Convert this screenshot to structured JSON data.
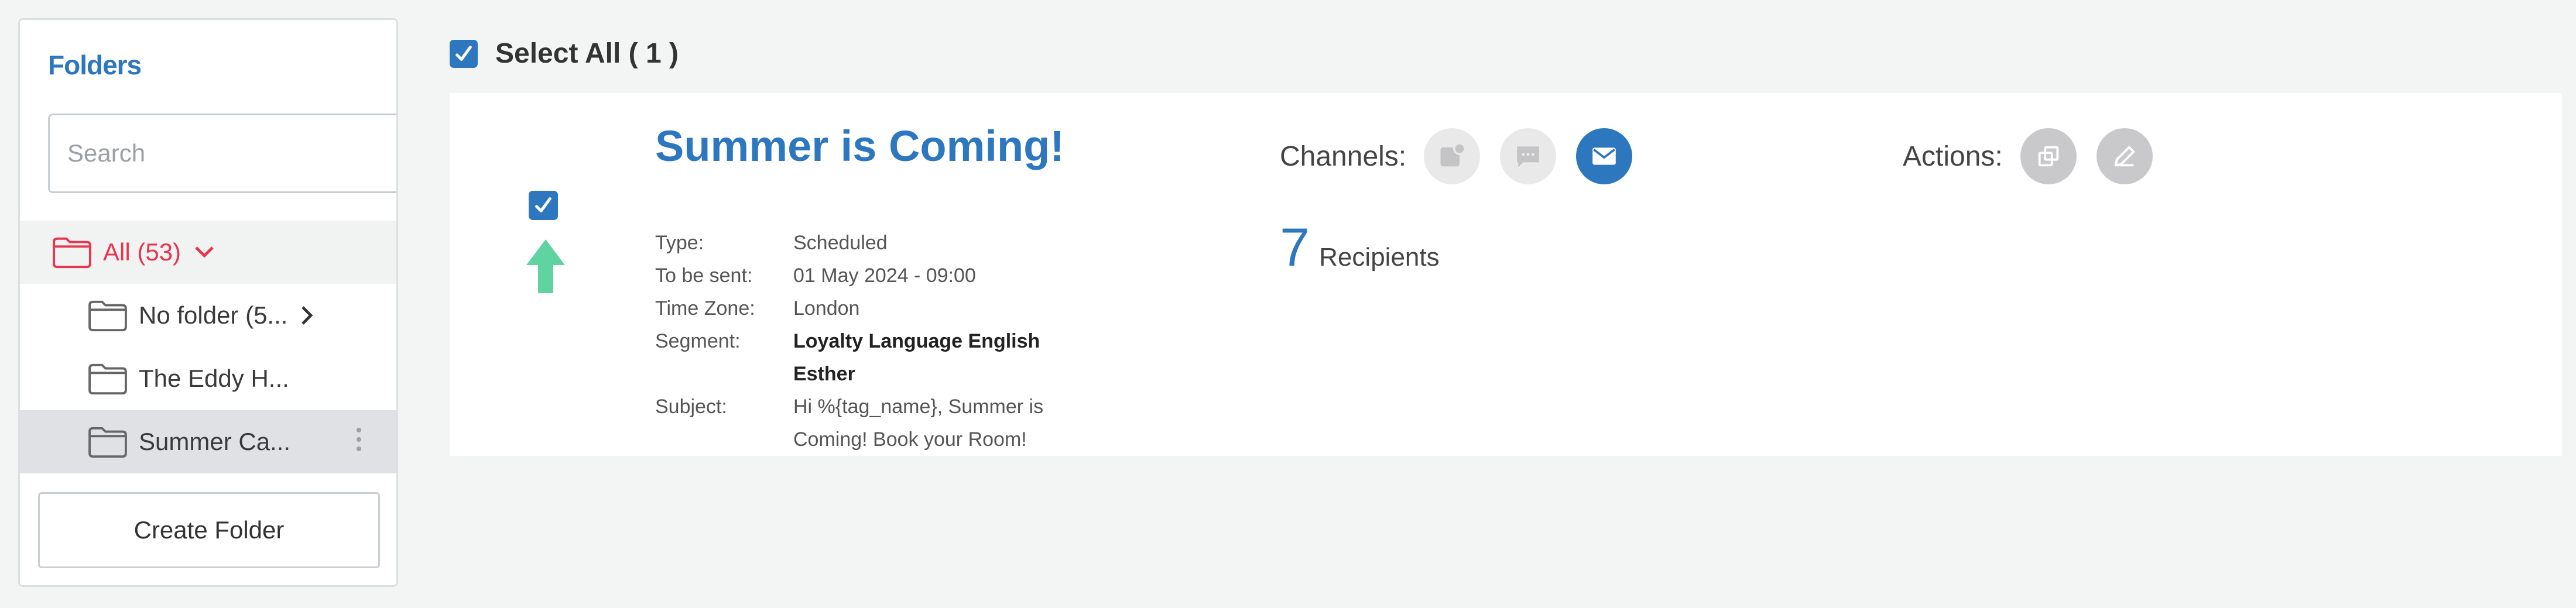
{
  "sidebar": {
    "title": "Folders",
    "search_placeholder": "Search",
    "folders": [
      {
        "label": "All (53)"
      },
      {
        "label": "No folder (5..."
      },
      {
        "label": "The Eddy H..."
      },
      {
        "label": "Summer Ca..."
      }
    ],
    "create_label": "Create Folder"
  },
  "main": {
    "select_all_label": "Select All ( 1 )",
    "campaign": {
      "title": "Summer is Coming!",
      "details": [
        {
          "key": "Type:",
          "value": "Scheduled"
        },
        {
          "key": "To be sent:",
          "value": "01 May 2024 - 09:00"
        },
        {
          "key": "Time Zone:",
          "value": "London"
        },
        {
          "key": "Segment:",
          "value": "Loyalty Language English Esther"
        },
        {
          "key": "Subject:",
          "value": "Hi %{tag_name}, Summer is Coming! Book your Room!"
        }
      ],
      "channels_label": "Channels:",
      "recipients_count": "7",
      "recipients_label": "Recipients",
      "actions_label": "Actions:"
    }
  },
  "colors": {
    "accent": "#2d77bf",
    "all_folder": "#e8344e",
    "priority_arrow": "#5fd3a0"
  }
}
